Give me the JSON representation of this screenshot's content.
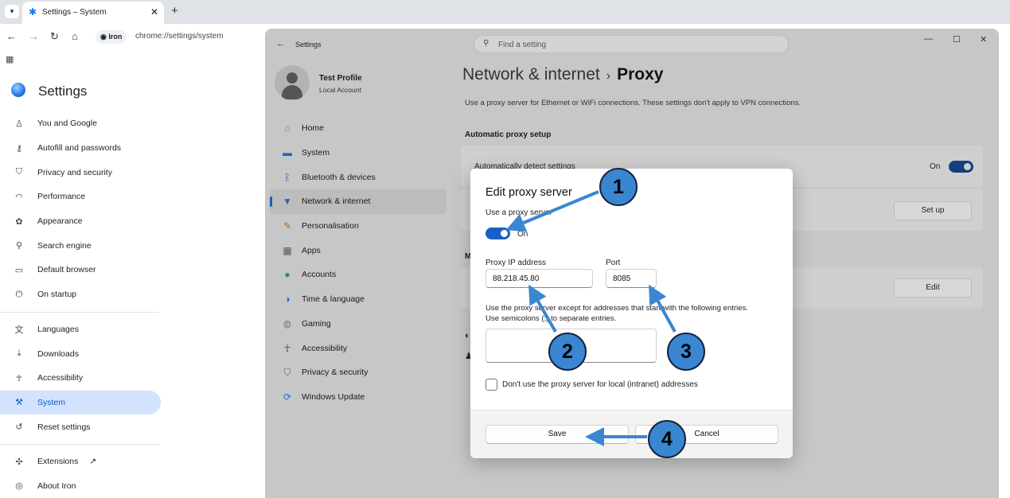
{
  "browser": {
    "tab_title": "Settings – System",
    "chip_label": "Iron",
    "url": "chrome://settings/system"
  },
  "chrome_settings": {
    "title": "Settings",
    "nav_group1": [
      {
        "label": "You and Google",
        "icon": "person-icon"
      },
      {
        "label": "Autofill and passwords",
        "icon": "key-icon"
      },
      {
        "label": "Privacy and security",
        "icon": "shield-icon"
      },
      {
        "label": "Performance",
        "icon": "gauge-icon"
      },
      {
        "label": "Appearance",
        "icon": "palette-icon"
      },
      {
        "label": "Search engine",
        "icon": "search-icon"
      },
      {
        "label": "Default browser",
        "icon": "browser-icon"
      },
      {
        "label": "On startup",
        "icon": "power-icon"
      }
    ],
    "nav_group2": [
      {
        "label": "Languages",
        "icon": "translate-icon"
      },
      {
        "label": "Downloads",
        "icon": "download-icon"
      },
      {
        "label": "Accessibility",
        "icon": "accessibility-icon"
      },
      {
        "label": "System",
        "icon": "wrench-icon",
        "active": true
      },
      {
        "label": "Reset settings",
        "icon": "reset-icon"
      }
    ],
    "nav_group3": [
      {
        "label": "Extensions",
        "icon": "puzzle-icon"
      },
      {
        "label": "About Iron",
        "icon": "iron-logo-icon"
      }
    ]
  },
  "win_settings": {
    "title": "Settings",
    "search_placeholder": "Find a setting",
    "profile_name": "Test Profile",
    "profile_sub": "Local Account",
    "nav": [
      {
        "label": "Home",
        "icon": "home-icon"
      },
      {
        "label": "System",
        "icon": "monitor-icon"
      },
      {
        "label": "Bluetooth & devices",
        "icon": "bluetooth-icon"
      },
      {
        "label": "Network & internet",
        "icon": "wifi-icon",
        "active": true
      },
      {
        "label": "Personalisation",
        "icon": "brush-icon"
      },
      {
        "label": "Apps",
        "icon": "apps-icon"
      },
      {
        "label": "Accounts",
        "icon": "account-icon"
      },
      {
        "label": "Time & language",
        "icon": "globe-icon"
      },
      {
        "label": "Gaming",
        "icon": "gamepad-icon"
      },
      {
        "label": "Accessibility",
        "icon": "accessibility-icon"
      },
      {
        "label": "Privacy & security",
        "icon": "shield-icon"
      },
      {
        "label": "Windows Update",
        "icon": "update-icon"
      }
    ],
    "breadcrumb_parent": "Network & internet",
    "breadcrumb_sep": "›",
    "breadcrumb_current": "Proxy",
    "description": "Use a proxy server for Ethernet or WiFi connections. These settings don't apply to VPN connections.",
    "auto_section": "Automatic proxy setup",
    "auto_detect_label": "Automatically detect settings",
    "auto_detect_state": "On",
    "setup_button": "Set up",
    "manual_section_letter": "M",
    "edit_button": "Edit"
  },
  "dialog": {
    "title": "Edit proxy server",
    "use_proxy_label": "Use a proxy server",
    "toggle_state": "On",
    "ip_label": "Proxy IP address",
    "ip_value": "88.218.45.80",
    "port_label": "Port",
    "port_value": "8085",
    "except_text_1": "Use the proxy server except for addresses that start with the following entries.",
    "except_text_2": "Use semicolons (;) to separate entries.",
    "local_checkbox_label": "Don't use the proxy server for local (intranet) addresses",
    "save_button": "Save",
    "cancel_button": "Cancel"
  },
  "annotations": {
    "badges": [
      "1",
      "2",
      "3",
      "4"
    ],
    "badge_color": "#3a86d1"
  }
}
